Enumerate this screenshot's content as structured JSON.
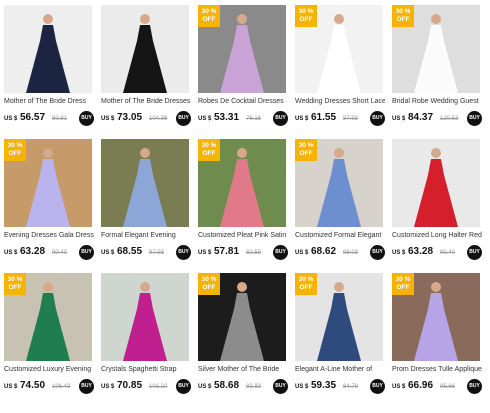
{
  "products": [
    {
      "title": "Mother of The Bride Dress",
      "currency": "US $",
      "price": "56.57",
      "old_price": "80.81",
      "buy": "BUY",
      "badge_pct": "",
      "badge_off": "",
      "bg": "#eeeeee",
      "dress": "#1b2440"
    },
    {
      "title": "Mother of The Bride Dresses",
      "currency": "US $",
      "price": "73.05",
      "old_price": "104.36",
      "buy": "BUY",
      "badge_pct": "",
      "badge_off": "",
      "bg": "#ebebeb",
      "dress": "#151515"
    },
    {
      "title": "Robes De Cocktail Dresses",
      "currency": "US $",
      "price": "53.31",
      "old_price": "76.16",
      "buy": "BUY",
      "badge_pct": "30 %",
      "badge_off": "OFF",
      "bg": "#8a8a8a",
      "dress": "#c9a2d6"
    },
    {
      "title": "Wedding Dresses Short Lace",
      "currency": "US $",
      "price": "61.55",
      "old_price": "87.93",
      "buy": "BUY",
      "badge_pct": "30 %",
      "badge_off": "OFF",
      "bg": "#f2f2f2",
      "dress": "#ffffff"
    },
    {
      "title": "Bridal Robe Wedding Guest",
      "currency": "US $",
      "price": "84.37",
      "old_price": "120.53",
      "buy": "BUY",
      "badge_pct": "30 %",
      "badge_off": "OFF",
      "bg": "#dedede",
      "dress": "#fbfbfb"
    },
    {
      "title": "Evening Dresses Gala Dress",
      "currency": "US $",
      "price": "63.28",
      "old_price": "90.40",
      "buy": "BUY",
      "badge_pct": "30 %",
      "badge_off": "OFF",
      "bg": "#c79a6a",
      "dress": "#b9b4ee"
    },
    {
      "title": "Formal Elegant Evening",
      "currency": "US $",
      "price": "68.55",
      "old_price": "97.93",
      "buy": "BUY",
      "badge_pct": "",
      "badge_off": "",
      "bg": "#7a7d52",
      "dress": "#8ca6d8"
    },
    {
      "title": "Customized Pleat Pink Satin",
      "currency": "US $",
      "price": "57.81",
      "old_price": "82.59",
      "buy": "BUY",
      "badge_pct": "30 %",
      "badge_off": "OFF",
      "bg": "#6f8c4f",
      "dress": "#e07a88"
    },
    {
      "title": "Customized Formal Elegant",
      "currency": "US $",
      "price": "68.62",
      "old_price": "98.03",
      "buy": "BUY",
      "badge_pct": "30 %",
      "badge_off": "OFF",
      "bg": "#d8d2cc",
      "dress": "#6d8fd0"
    },
    {
      "title": "Customized Long Halter Red",
      "currency": "US $",
      "price": "63.28",
      "old_price": "90.40",
      "buy": "BUY",
      "badge_pct": "",
      "badge_off": "",
      "bg": "#e9e9e9",
      "dress": "#d51f2b"
    },
    {
      "title": "Customized Luxury Evening",
      "currency": "US $",
      "price": "74.50",
      "old_price": "106.43",
      "buy": "BUY",
      "badge_pct": "30 %",
      "badge_off": "OFF",
      "bg": "#c8c2b2",
      "dress": "#1f7d4e"
    },
    {
      "title": "Crystals Spaghetti Strap",
      "currency": "US $",
      "price": "70.85",
      "old_price": "101.22",
      "buy": "BUY",
      "badge_pct": "",
      "badge_off": "",
      "bg": "#cfd6cf",
      "dress": "#c0208f"
    },
    {
      "title": "Silver Mother of The Bride",
      "currency": "US $",
      "price": "58.68",
      "old_price": "83.83",
      "buy": "BUY",
      "badge_pct": "30 %",
      "badge_off": "OFF",
      "bg": "#1c1c1c",
      "dress": "#8c8c8c"
    },
    {
      "title": "Elegant A-Line Mother of",
      "currency": "US $",
      "price": "59.35",
      "old_price": "84.79",
      "buy": "BUY",
      "badge_pct": "30 %",
      "badge_off": "OFF",
      "bg": "#e4e4e4",
      "dress": "#2f4a7c"
    },
    {
      "title": "Prom Dresses Tulle Applique",
      "currency": "US $",
      "price": "66.96",
      "old_price": "95.66",
      "buy": "BUY",
      "badge_pct": "30 %",
      "badge_off": "OFF",
      "bg": "#8a6a5a",
      "dress": "#b7a4e6"
    }
  ],
  "colors": {
    "badge": "#f6b400",
    "buy": "#111111"
  }
}
